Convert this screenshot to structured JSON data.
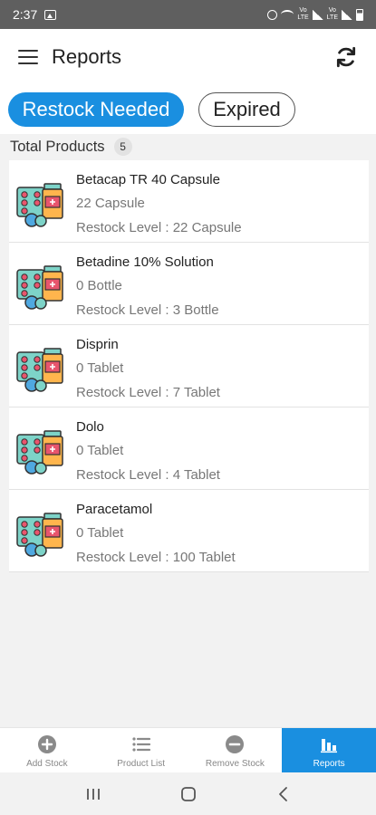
{
  "status_bar": {
    "time": "2:37",
    "network_label": "VoLTE"
  },
  "app_bar": {
    "title": "Reports"
  },
  "tabs": [
    {
      "label": "Restock Needed",
      "active": true
    },
    {
      "label": "Expired",
      "active": false
    }
  ],
  "summary": {
    "label": "Total Products",
    "count": "5"
  },
  "products": [
    {
      "name": "Betacap TR 40 Capsule",
      "quantity": "22 Capsule",
      "restock": "Restock Level : 22 Capsule"
    },
    {
      "name": "Betadine 10% Solution",
      "quantity": "0 Bottle",
      "restock": "Restock Level : 3 Bottle"
    },
    {
      "name": "Disprin",
      "quantity": "0 Tablet",
      "restock": "Restock Level : 7 Tablet"
    },
    {
      "name": "Dolo",
      "quantity": "0 Tablet",
      "restock": "Restock Level : 4 Tablet"
    },
    {
      "name": "Paracetamol",
      "quantity": "0 Tablet",
      "restock": "Restock Level : 100 Tablet"
    }
  ],
  "bottom_nav": [
    {
      "label": "Add Stock",
      "icon": "plus-circle-icon"
    },
    {
      "label": "Product List",
      "icon": "list-icon"
    },
    {
      "label": "Remove Stock",
      "icon": "minus-circle-icon"
    },
    {
      "label": "Reports",
      "icon": "bar-chart-icon",
      "active": true
    }
  ],
  "colors": {
    "accent": "#1a8fe0",
    "status_bar": "#5f5f5f",
    "background": "#f2f2f2"
  }
}
